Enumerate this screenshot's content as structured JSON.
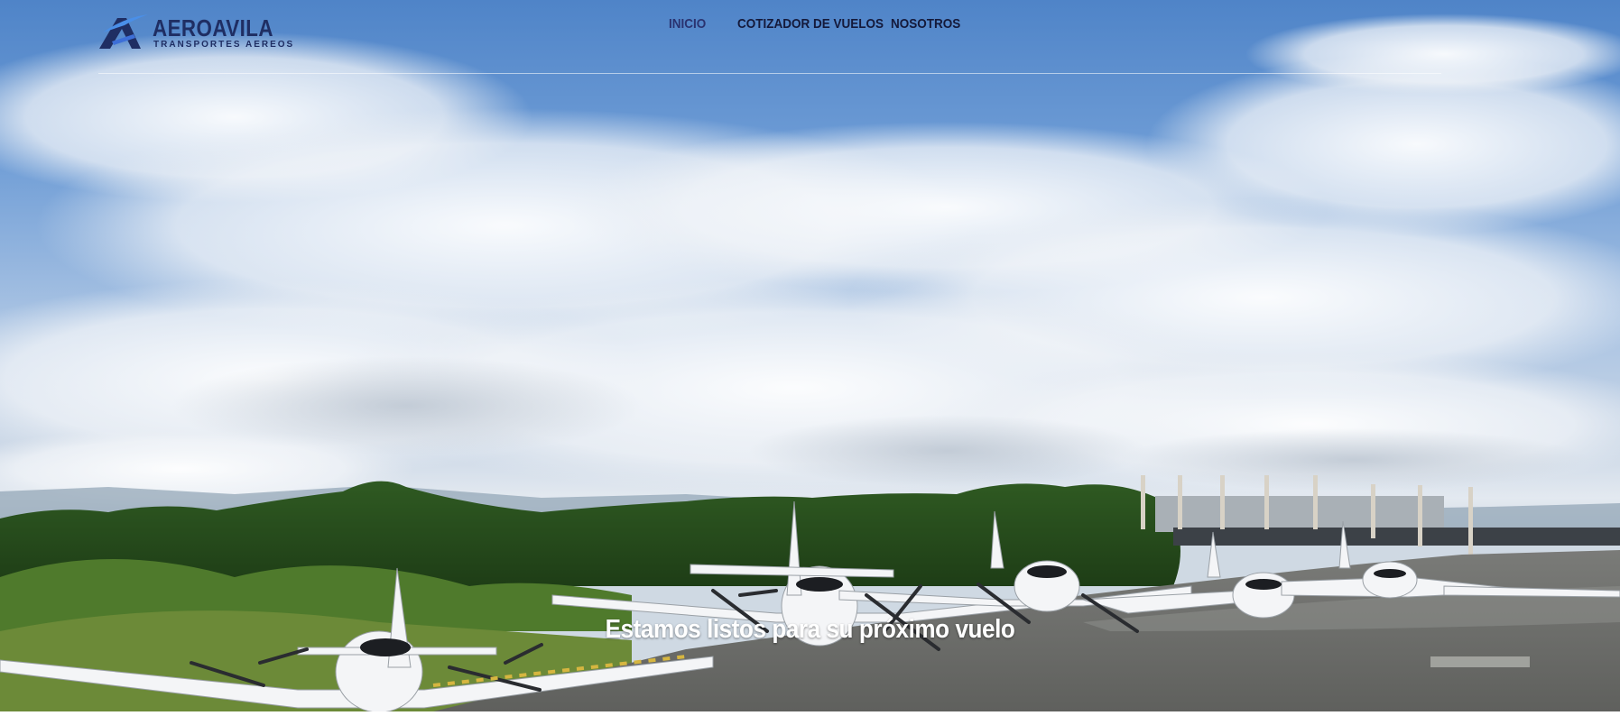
{
  "brand": {
    "name": "AEROAVILA",
    "tagline": "TRANSPORTES AEREOS"
  },
  "nav": {
    "items": [
      {
        "label": "INICIO",
        "active": true
      },
      {
        "label": "COTIZADOR DE VUELOS",
        "active": false
      },
      {
        "label": "NOSOTROS",
        "active": false
      }
    ]
  },
  "hero": {
    "headline": "Estamos listos para su próximo vuelo",
    "image": "aircraft-fleet-on-apron-photo"
  },
  "colors": {
    "brand_navy": "#1f2e63",
    "brand_accent": "#3d6fd8",
    "nav_text": "#14193a",
    "headline": "#ffffff"
  }
}
